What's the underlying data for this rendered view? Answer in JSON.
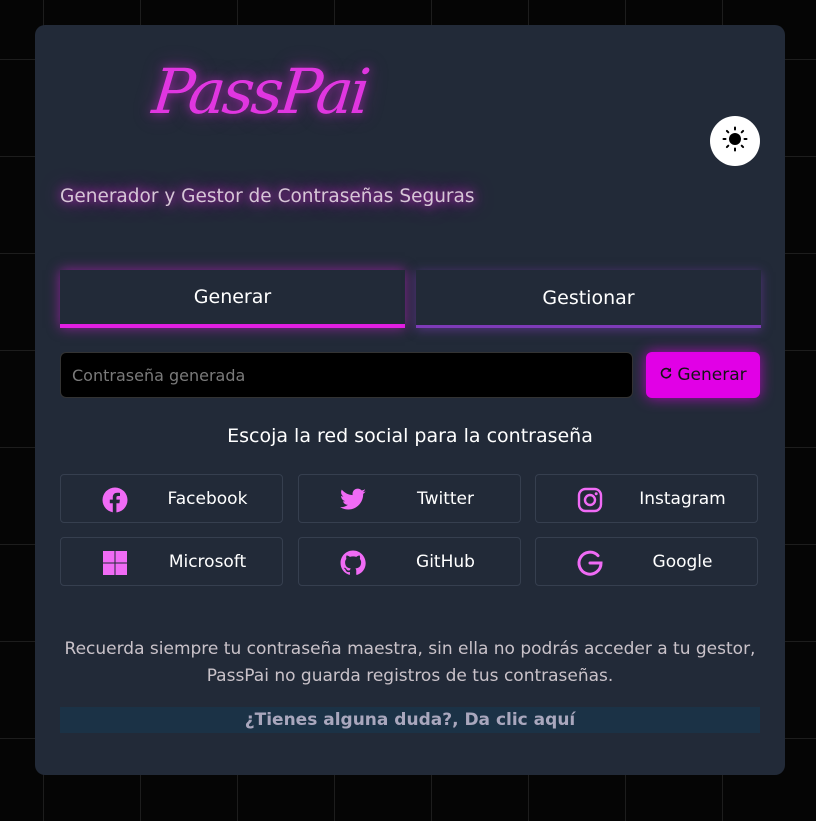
{
  "brand": {
    "logo_text": "PassPai",
    "subtitle": "Generador y Gestor de Contraseñas Seguras"
  },
  "theme_toggle": {
    "icon": "sun-icon"
  },
  "tabs": [
    {
      "label": "Generar",
      "active": true
    },
    {
      "label": "Gestionar",
      "active": false
    }
  ],
  "generator": {
    "placeholder": "Contraseña generada",
    "value": "",
    "button_label": "Generar",
    "button_icon": "refresh-icon"
  },
  "social": {
    "prompt": "Escoja la red social para la contraseña",
    "items": [
      {
        "label": "Facebook",
        "icon": "facebook-icon"
      },
      {
        "label": "Twitter",
        "icon": "twitter-icon"
      },
      {
        "label": "Instagram",
        "icon": "instagram-icon"
      },
      {
        "label": "Microsoft",
        "icon": "microsoft-icon"
      },
      {
        "label": "GitHub",
        "icon": "github-icon"
      },
      {
        "label": "Google",
        "icon": "google-icon"
      }
    ]
  },
  "footer": {
    "note": "Recuerda siempre tu contraseña maestra, sin ella no podrás acceder a tu gestor, PassPai no guarda registros de tus contraseñas.",
    "help_link": "¿Tienes alguna duda?, Da clic aquí"
  },
  "colors": {
    "accent": "#e100e6",
    "accent_secondary": "#7e3bb8",
    "card_bg": "#222a38",
    "icon_color": "#f06bf5",
    "page_bg": "#050505"
  }
}
